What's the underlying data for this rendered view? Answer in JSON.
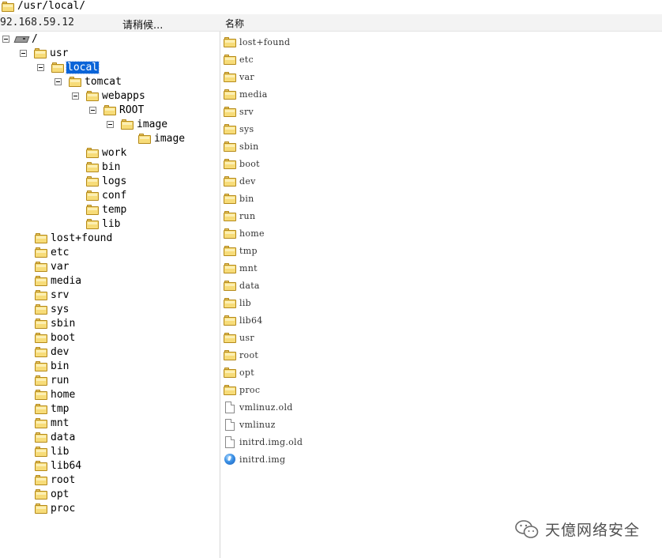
{
  "path_bar": {
    "path": "/usr/local/",
    "icon": "folder-icon"
  },
  "header": {
    "host": "92.168.59.12",
    "status": "请稍候...",
    "column_name": "名称"
  },
  "tree": {
    "root_label": "/",
    "usr": "usr",
    "local": "local",
    "tomcat": "tomcat",
    "webapps": "webapps",
    "root_dir": "ROOT",
    "image": "image",
    "image_child": "image",
    "work": "work",
    "bin_t": "bin",
    "logs": "logs",
    "conf": "conf",
    "temp": "temp",
    "lib_t": "lib",
    "top": [
      "lost+found",
      "etc",
      "var",
      "media",
      "srv",
      "sys",
      "sbin",
      "boot",
      "dev",
      "bin",
      "run",
      "home",
      "tmp",
      "mnt",
      "data",
      "lib",
      "lib64",
      "root",
      "opt",
      "proc"
    ]
  },
  "list": {
    "items": [
      {
        "name": "lost+found",
        "icon": "folder-icon"
      },
      {
        "name": "etc",
        "icon": "folder-icon"
      },
      {
        "name": "var",
        "icon": "folder-icon"
      },
      {
        "name": "media",
        "icon": "folder-icon"
      },
      {
        "name": "srv",
        "icon": "folder-icon"
      },
      {
        "name": "sys",
        "icon": "folder-icon"
      },
      {
        "name": "sbin",
        "icon": "folder-icon"
      },
      {
        "name": "boot",
        "icon": "folder-icon"
      },
      {
        "name": "dev",
        "icon": "folder-icon"
      },
      {
        "name": "bin",
        "icon": "folder-icon"
      },
      {
        "name": "run",
        "icon": "folder-icon"
      },
      {
        "name": "home",
        "icon": "folder-icon"
      },
      {
        "name": "tmp",
        "icon": "folder-icon"
      },
      {
        "name": "mnt",
        "icon": "folder-icon"
      },
      {
        "name": "data",
        "icon": "folder-icon"
      },
      {
        "name": "lib",
        "icon": "folder-icon"
      },
      {
        "name": "lib64",
        "icon": "folder-icon"
      },
      {
        "name": "usr",
        "icon": "folder-icon"
      },
      {
        "name": "root",
        "icon": "folder-icon"
      },
      {
        "name": "opt",
        "icon": "folder-icon"
      },
      {
        "name": "proc",
        "icon": "folder-icon"
      },
      {
        "name": "vmlinuz.old",
        "icon": "file-icon"
      },
      {
        "name": "vmlinuz",
        "icon": "file-icon"
      },
      {
        "name": "initrd.img.old",
        "icon": "file-icon"
      },
      {
        "name": "initrd.img",
        "icon": "image-file-icon"
      }
    ]
  },
  "watermark": {
    "text": "天億网络安全",
    "icon": "wechat-logo-icon"
  }
}
